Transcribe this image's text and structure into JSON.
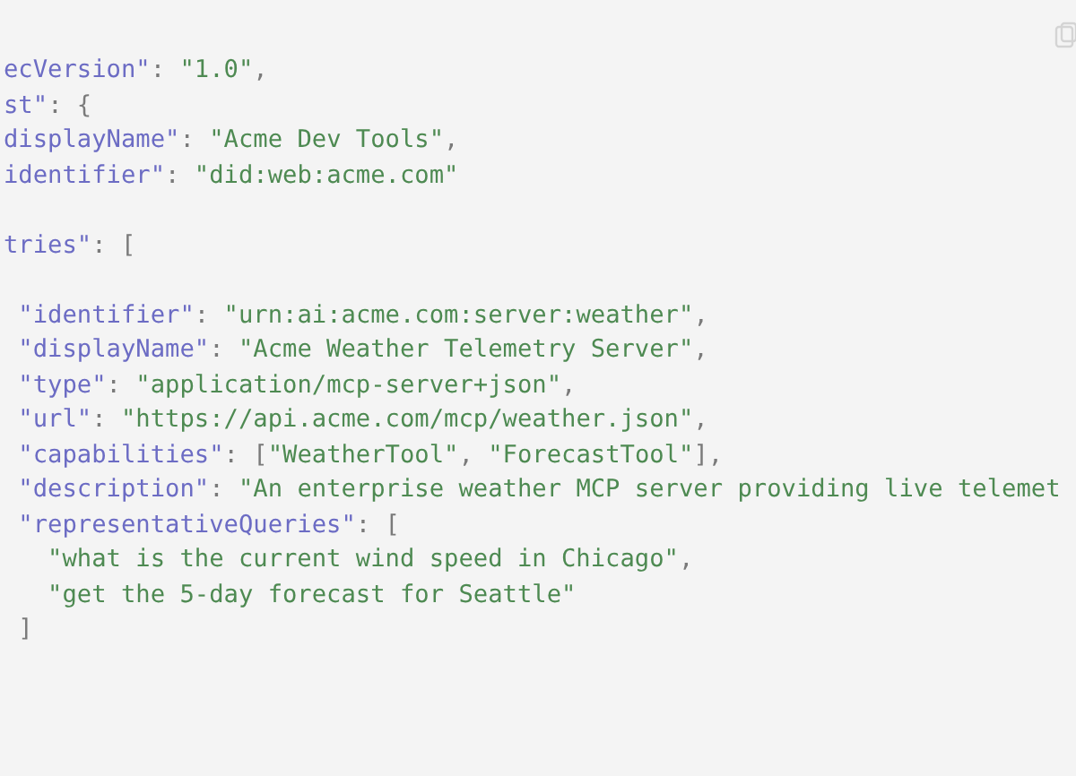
{
  "code_block": {
    "lines": [
      {
        "kind": "code",
        "tokens": [
          {
            "kind": "key",
            "text": "ecVersion\""
          },
          {
            "kind": "punct",
            "text": ": "
          },
          {
            "kind": "string",
            "text": "\"1.0\""
          },
          {
            "kind": "punct",
            "text": ","
          }
        ]
      },
      {
        "kind": "code",
        "tokens": [
          {
            "kind": "key",
            "text": "st\""
          },
          {
            "kind": "punct",
            "text": ": {"
          }
        ]
      },
      {
        "kind": "code",
        "tokens": [
          {
            "kind": "key",
            "text": "displayName\""
          },
          {
            "kind": "punct",
            "text": ": "
          },
          {
            "kind": "string",
            "text": "\"Acme Dev Tools\""
          },
          {
            "kind": "punct",
            "text": ","
          }
        ]
      },
      {
        "kind": "code",
        "tokens": [
          {
            "kind": "key",
            "text": "identifier\""
          },
          {
            "kind": "punct",
            "text": ": "
          },
          {
            "kind": "string",
            "text": "\"did:web:acme.com\""
          }
        ]
      },
      {
        "kind": "blank"
      },
      {
        "kind": "code",
        "tokens": [
          {
            "kind": "key",
            "text": "tries\""
          },
          {
            "kind": "punct",
            "text": ": ["
          }
        ]
      },
      {
        "kind": "blank"
      },
      {
        "kind": "code",
        "tokens": [
          {
            "kind": "key",
            "text": " \"identifier\""
          },
          {
            "kind": "punct",
            "text": ": "
          },
          {
            "kind": "string",
            "text": "\"urn:ai:acme.com:server:weather\""
          },
          {
            "kind": "punct",
            "text": ","
          }
        ]
      },
      {
        "kind": "code",
        "tokens": [
          {
            "kind": "key",
            "text": " \"displayName\""
          },
          {
            "kind": "punct",
            "text": ": "
          },
          {
            "kind": "string",
            "text": "\"Acme Weather Telemetry Server\""
          },
          {
            "kind": "punct",
            "text": ","
          }
        ]
      },
      {
        "kind": "code",
        "tokens": [
          {
            "kind": "key",
            "text": " \"type\""
          },
          {
            "kind": "punct",
            "text": ": "
          },
          {
            "kind": "string",
            "text": "\"application/mcp-server+json\""
          },
          {
            "kind": "punct",
            "text": ","
          }
        ]
      },
      {
        "kind": "code",
        "tokens": [
          {
            "kind": "key",
            "text": " \"url\""
          },
          {
            "kind": "punct",
            "text": ": "
          },
          {
            "kind": "string",
            "text": "\"https://api.acme.com/mcp/weather.json\""
          },
          {
            "kind": "punct",
            "text": ","
          }
        ]
      },
      {
        "kind": "code",
        "tokens": [
          {
            "kind": "key",
            "text": " \"capabilities\""
          },
          {
            "kind": "punct",
            "text": ": ["
          },
          {
            "kind": "string",
            "text": "\"WeatherTool\""
          },
          {
            "kind": "punct",
            "text": ", "
          },
          {
            "kind": "string",
            "text": "\"ForecastTool\""
          },
          {
            "kind": "punct",
            "text": "],"
          }
        ]
      },
      {
        "kind": "code",
        "tokens": [
          {
            "kind": "key",
            "text": " \"description\""
          },
          {
            "kind": "punct",
            "text": ": "
          },
          {
            "kind": "string",
            "text": "\"An enterprise weather MCP server providing live telemet"
          }
        ]
      },
      {
        "kind": "code",
        "tokens": [
          {
            "kind": "key",
            "text": " \"representativeQueries\""
          },
          {
            "kind": "punct",
            "text": ": ["
          }
        ]
      },
      {
        "kind": "code",
        "tokens": [
          {
            "kind": "string",
            "text": "   \"what is the current wind speed in Chicago\""
          },
          {
            "kind": "punct",
            "text": ","
          }
        ]
      },
      {
        "kind": "code",
        "tokens": [
          {
            "kind": "string",
            "text": "   \"get the 5-day forecast for Seattle\""
          }
        ]
      },
      {
        "kind": "code",
        "tokens": [
          {
            "kind": "punct",
            "text": " ]"
          }
        ]
      }
    ]
  }
}
